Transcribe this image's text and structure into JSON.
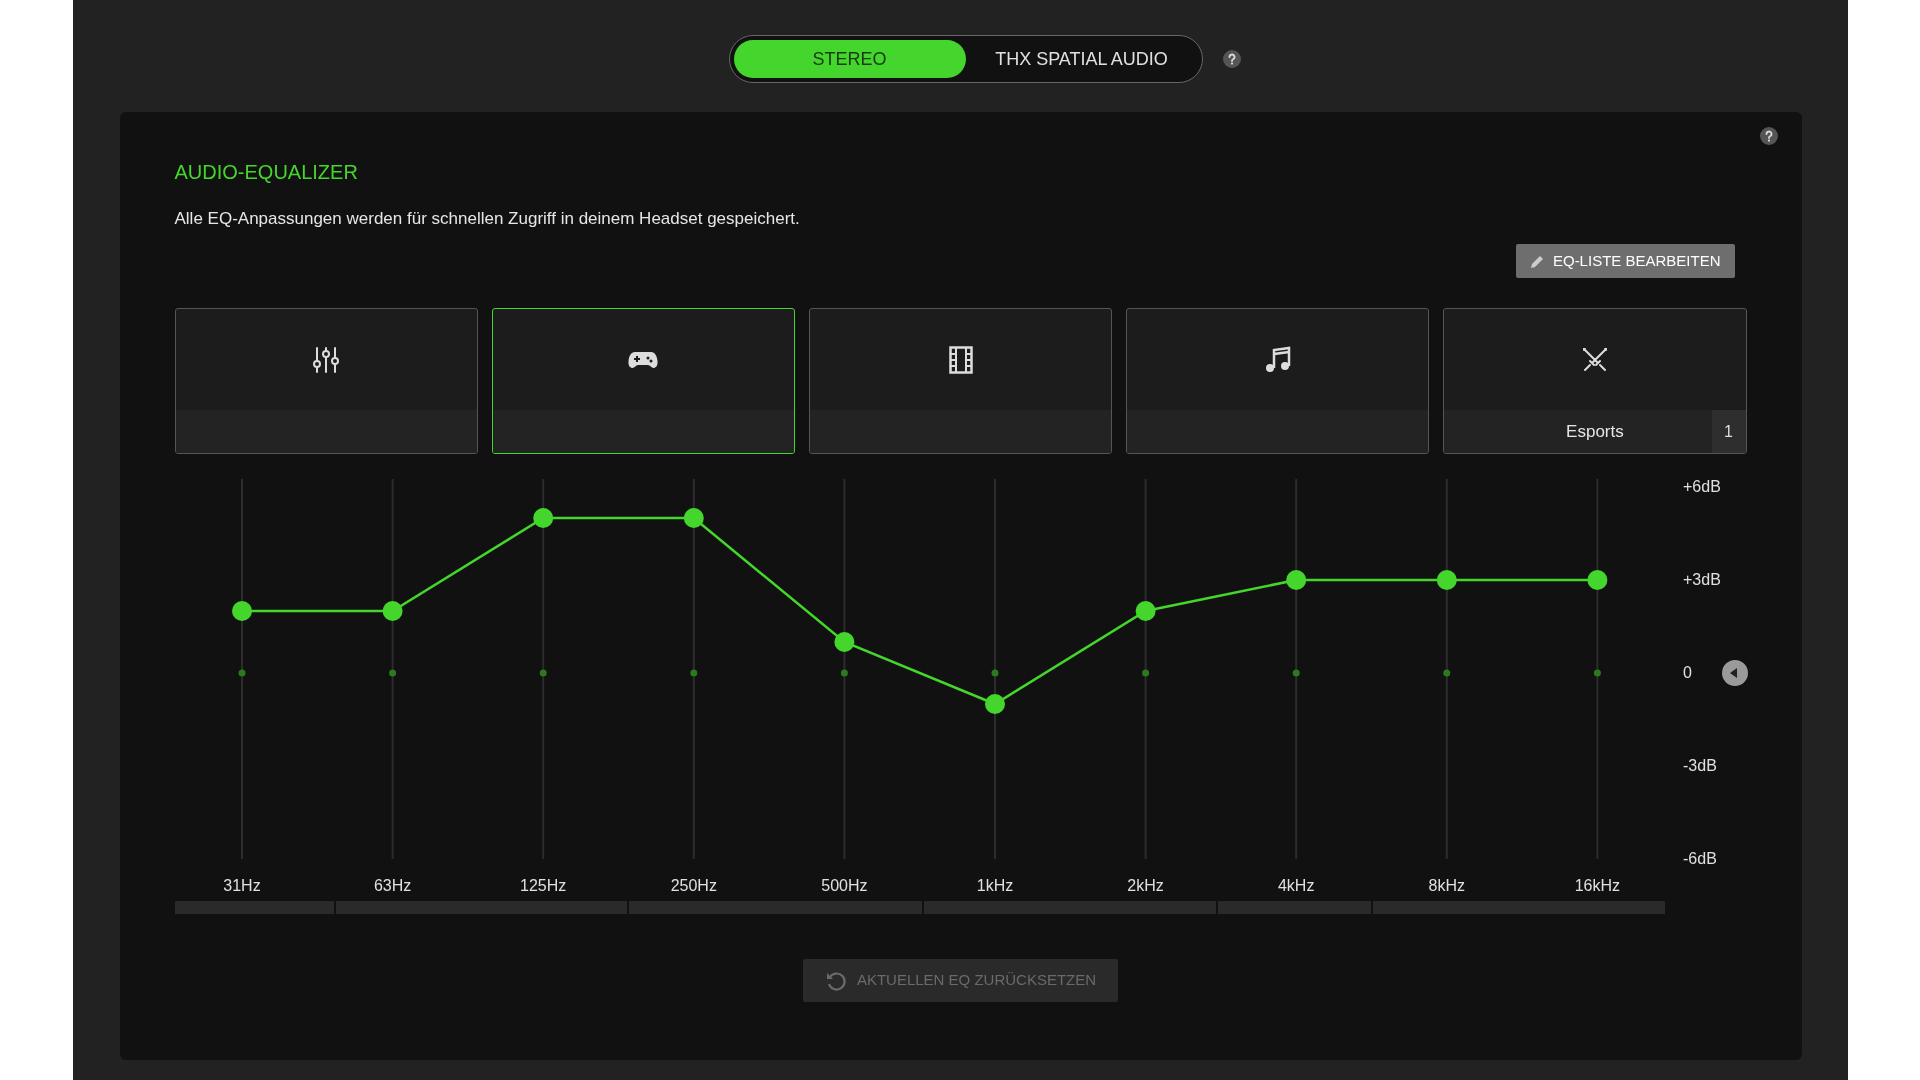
{
  "mode_toggle": [
    {
      "label": "STEREO",
      "selected": true
    },
    {
      "label": "THX SPATIAL AUDIO",
      "selected": false
    }
  ],
  "equalizer": {
    "title": "AUDIO-EQUALIZER",
    "description": "Alle EQ-Anpassungen werden für schnellen Zugriff in deinem Headset gespeichert.",
    "edit_button": "EQ-LISTE BEARBEITEN",
    "presets": [
      {
        "kind": "custom",
        "selected": false
      },
      {
        "kind": "game",
        "selected": true
      },
      {
        "kind": "movie",
        "selected": false
      },
      {
        "kind": "music",
        "selected": false
      },
      {
        "kind": "esports",
        "selected": false,
        "label": "Esports",
        "badge": "1"
      }
    ],
    "chart_data": {
      "type": "line",
      "categories": [
        "31Hz",
        "63Hz",
        "125Hz",
        "250Hz",
        "500Hz",
        "1kHz",
        "2kHz",
        "4kHz",
        "8kHz",
        "16kHz"
      ],
      "grid": true,
      "series": [
        {
          "color": "#44d62c",
          "marker": true,
          "values": [
            2,
            2,
            5,
            5,
            1,
            -1,
            2,
            3,
            3,
            3
          ]
        }
      ],
      "ylim": [
        -6,
        6
      ],
      "yticks": [
        {
          "value": 6,
          "label": "+6dB"
        },
        {
          "value": 3,
          "label": "+3dB"
        },
        {
          "value": 0,
          "label": "0"
        },
        {
          "value": -3,
          "label": "-3dB"
        },
        {
          "value": -6,
          "label": "-6dB"
        }
      ]
    },
    "reset_button": {
      "label": "AKTUELLEN EQ ZURÜCKSETZEN",
      "disabled": true
    }
  }
}
